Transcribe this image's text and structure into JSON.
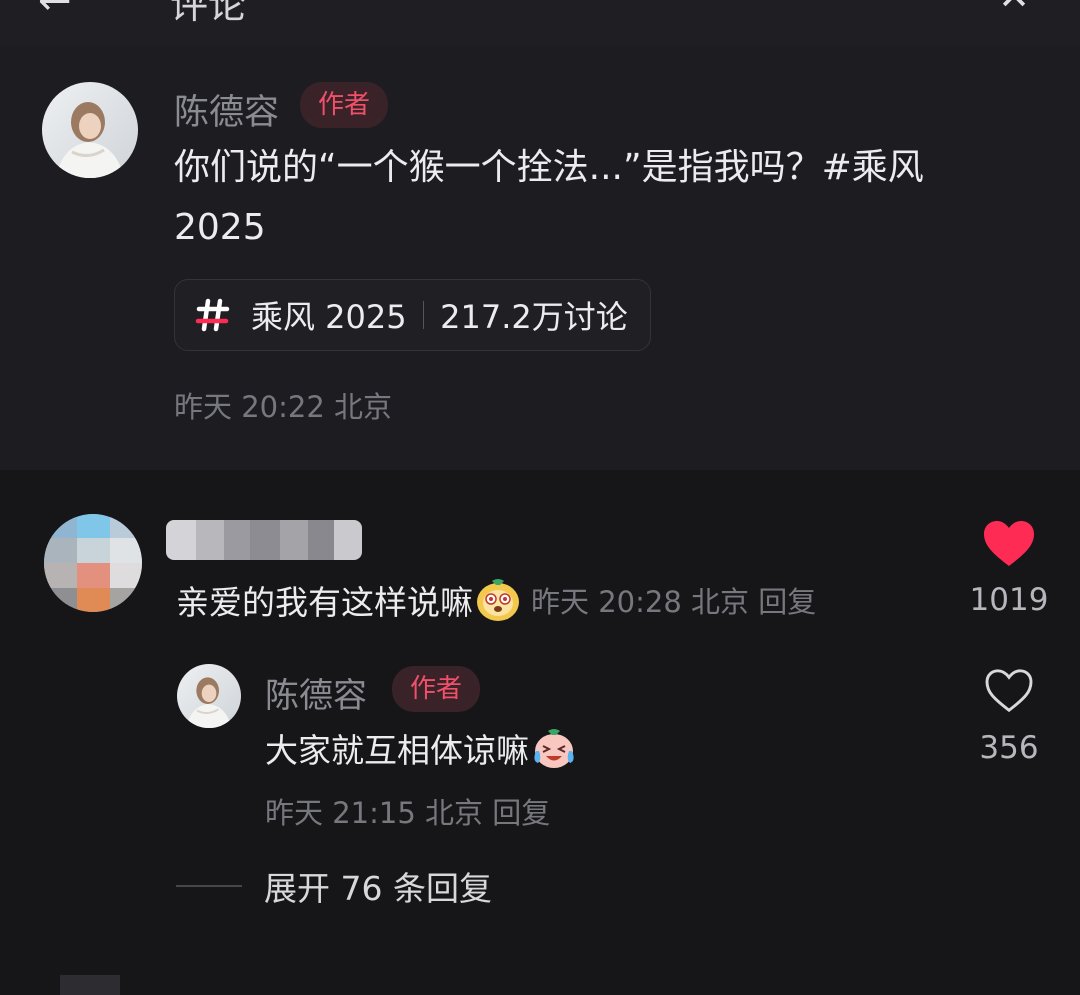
{
  "topbar": {
    "back_icon": "back-arrow-icon",
    "title": "评论",
    "close_icon": "close-icon"
  },
  "post": {
    "author": "陈德容",
    "author_badge": "作者",
    "text": "你们说的“一个猴一个拴法...”是指我吗？#乘风2025",
    "topic": {
      "icon": "hashtag-icon",
      "name": "乘风 2025",
      "count": "217.2万讨论"
    },
    "meta": "昨天 20:22 北京"
  },
  "comments": [
    {
      "text": "亲爱的我有这样说嘛",
      "emoji": "puppy-emoji",
      "meta": "昨天 20:28 北京 回复",
      "like_icon": "heart-filled-icon",
      "like_count": "1019",
      "reply": {
        "author": "陈德容",
        "author_badge": "作者",
        "text": "大家就互相体谅嘛",
        "emoji": "laugh-cry-emoji",
        "meta": "昨天 21:15 北京 回复",
        "like_icon": "heart-outline-icon",
        "like_count": "356"
      },
      "expand_label": "展开 76 条回复"
    }
  ],
  "colors": {
    "background": "#1c1c21",
    "comments_background": "#161619",
    "badge_text": "#f0506a",
    "badge_bg": "#3a2328",
    "like_red": "#fe2c55",
    "muted_text": "#77777e"
  }
}
